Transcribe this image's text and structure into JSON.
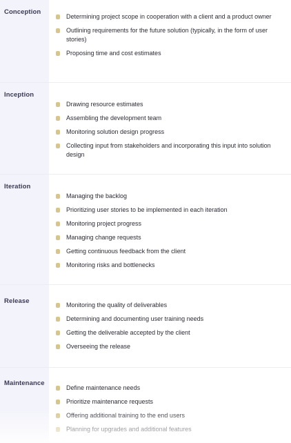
{
  "phases": [
    {
      "name": "Conception",
      "items": [
        "Determining project scope in cooperation with a client and a product owner",
        "Outlining requirements for the future solution (typically, in the form of user stories)",
        "Proposing time and cost estimates"
      ]
    },
    {
      "name": "Inception",
      "items": [
        "Drawing resource estimates",
        "Assembling the development team",
        "Monitoring solution design progress",
        "Collecting input from stakeholders and incorporating this input into solution design"
      ]
    },
    {
      "name": "Iteration",
      "items": [
        "Managing the backlog",
        "Prioritizing user stories to be implemented in each iteration",
        "Monitoring project progress",
        "Managing change requests",
        "Getting continuous feedback from the client",
        "Monitoring risks and bottlenecks"
      ]
    },
    {
      "name": "Release",
      "items": [
        "Monitoring the quality of deliverables",
        "Determining and documenting user training needs",
        "Getting the deliverable accepted by the client",
        "Overseeing the release"
      ]
    },
    {
      "name": "Maintenance",
      "items": [
        "Define maintenance needs",
        "Prioritize maintenance requests",
        "Offering additional training to the end users",
        "Planning for upgrades and additional features"
      ]
    }
  ],
  "colors": {
    "bullet": "#d8c58c",
    "label_column_bg": "#f3f3fb"
  }
}
